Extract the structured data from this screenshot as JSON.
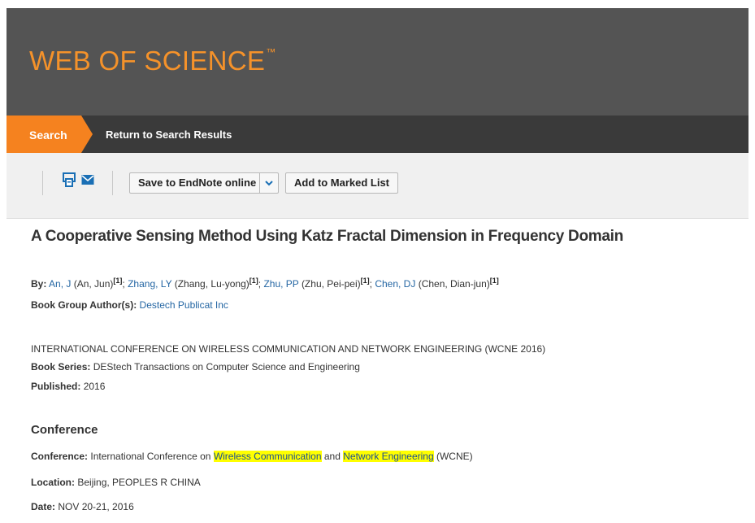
{
  "brand": {
    "name": "WEB OF SCIENCE",
    "tm": "™"
  },
  "nav": {
    "search_tab": "Search",
    "return_link": "Return to Search Results"
  },
  "toolbar": {
    "save_label": "Save to EndNote online",
    "marked_label": "Add to Marked List"
  },
  "record": {
    "title": "A Cooperative Sensing Method Using Katz Fractal Dimension in Frequency Domain",
    "by_label": "By:",
    "authors": [
      {
        "short": "An, J",
        "full": "(An, Jun)",
        "aff": "[1]",
        "sep": ";"
      },
      {
        "short": "Zhang, LY",
        "full": "(Zhang, Lu-yong)",
        "aff": "[1]",
        "sep": ";"
      },
      {
        "short": "Zhu, PP",
        "full": "(Zhu, Pei-pei)",
        "aff": "[1]",
        "sep": ";"
      },
      {
        "short": "Chen, DJ",
        "full": "(Chen, Dian-jun)",
        "aff": "[1]",
        "sep": ""
      }
    ],
    "group_label": "Book Group Author(s):",
    "group_value": "Destech Publicat Inc",
    "source": "INTERNATIONAL CONFERENCE ON WIRELESS COMMUNICATION AND NETWORK ENGINEERING (WCNE 2016)",
    "series_label": "Book Series:",
    "series_value": "DEStech Transactions on Computer Science and Engineering",
    "published_label": "Published:",
    "published_value": "2016"
  },
  "conference": {
    "heading": "Conference",
    "conf_label": "Conference:",
    "conf_prefix": "International Conference on",
    "conf_hl1": "Wireless Communication",
    "conf_mid": "and",
    "conf_hl2": "Network Engineering",
    "conf_suffix": "(WCNE)",
    "location_label": "Location:",
    "location_value": "Beijing, PEOPLES R CHINA",
    "date_label": "Date:",
    "date_value": "NOV 20-21, 2016"
  },
  "colors": {
    "brand": "#f5922a",
    "header": "#545454",
    "nav": "#3a3a3a",
    "accent": "#f5821f",
    "link": "#2466a3",
    "highlight": "#ffff00"
  }
}
